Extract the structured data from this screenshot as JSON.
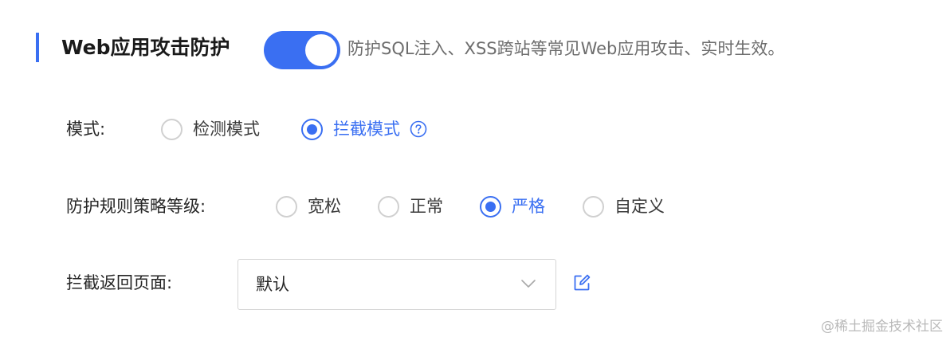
{
  "section": {
    "title": "Web应用攻击防护",
    "toggle_on": true,
    "description": "防护SQL注入、XSS跨站等常见Web应用攻击、实时生效。"
  },
  "mode": {
    "label": "模式:",
    "options": [
      {
        "label": "检测模式",
        "checked": false
      },
      {
        "label": "拦截模式",
        "checked": true
      }
    ],
    "help_icon": "question-circle-icon"
  },
  "policy_level": {
    "label": "防护规则策略等级:",
    "options": [
      {
        "label": "宽松",
        "checked": false
      },
      {
        "label": "正常",
        "checked": false
      },
      {
        "label": "严格",
        "checked": true
      },
      {
        "label": "自定义",
        "checked": false
      }
    ]
  },
  "block_page": {
    "label": "拦截返回页面:",
    "selected": "默认",
    "dropdown_icon": "chevron-down-icon",
    "edit_icon": "edit-icon"
  },
  "watermark": "@稀土掘金技术社区",
  "colors": {
    "accent": "#3a6ff2",
    "text": "#262626",
    "muted": "#6d6d6d",
    "border": "#d6d6d6"
  }
}
